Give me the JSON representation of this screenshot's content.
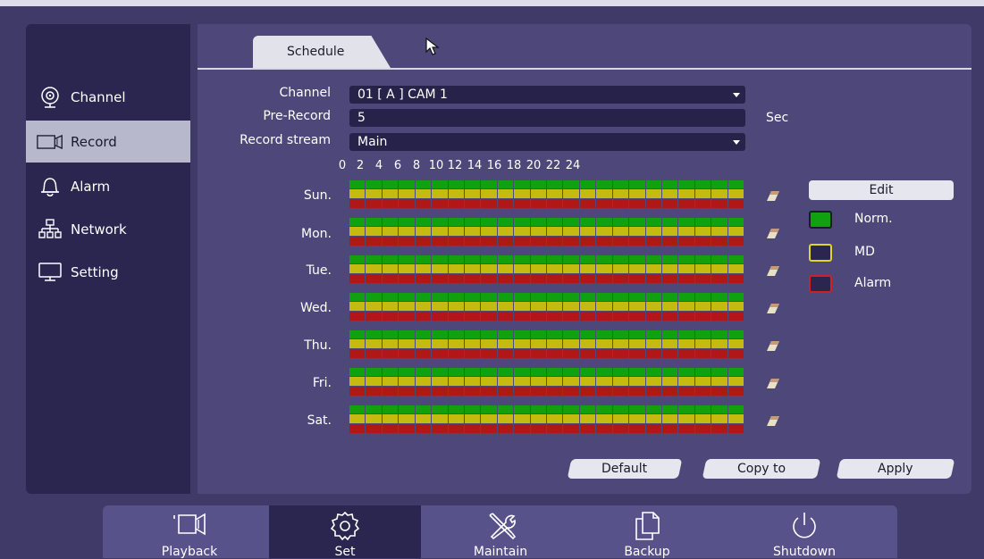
{
  "sidebar": {
    "items": [
      {
        "label": "Channel",
        "icon": "camera-icon",
        "active": false
      },
      {
        "label": "Record",
        "icon": "video-record-icon",
        "active": true
      },
      {
        "label": "Alarm",
        "icon": "bell-icon",
        "active": false
      },
      {
        "label": "Network",
        "icon": "network-icon",
        "active": false
      },
      {
        "label": "Setting",
        "icon": "monitor-icon",
        "active": false
      }
    ]
  },
  "tabs": [
    {
      "label": "Schedule",
      "active": true
    }
  ],
  "form": {
    "channel_label": "Channel",
    "channel_value": "01 [ A ] CAM 1",
    "prerecord_label": "Pre-Record",
    "prerecord_value": "5",
    "prerecord_unit": "Sec",
    "stream_label": "Record stream",
    "stream_value": "Main"
  },
  "schedule": {
    "hours": [
      "0",
      "2",
      "4",
      "6",
      "8",
      "10",
      "12",
      "14",
      "16",
      "18",
      "20",
      "22",
      "24"
    ],
    "days": [
      "Sun.",
      "Mon.",
      "Tue.",
      "Wed.",
      "Thu.",
      "Fri.",
      "Sat."
    ],
    "colors": {
      "norm": "#10a010",
      "md": "#c4ba10",
      "alarm": "#b01818"
    }
  },
  "legend": {
    "edit_label": "Edit",
    "norm_label": "Norm.",
    "md_label": "MD",
    "alarm_label": "Alarm"
  },
  "buttons": {
    "default_label": "Default",
    "copy_label": "Copy to",
    "apply_label": "Apply"
  },
  "bottom_nav": [
    {
      "label": "Playback",
      "icon": "playback-icon",
      "active": false
    },
    {
      "label": "Set",
      "icon": "settings-gear-icon",
      "active": true
    },
    {
      "label": "Maintain",
      "icon": "tools-icon",
      "active": false
    },
    {
      "label": "Backup",
      "icon": "backup-files-icon",
      "active": false
    },
    {
      "label": "Shutdown",
      "icon": "power-icon",
      "active": false
    }
  ]
}
